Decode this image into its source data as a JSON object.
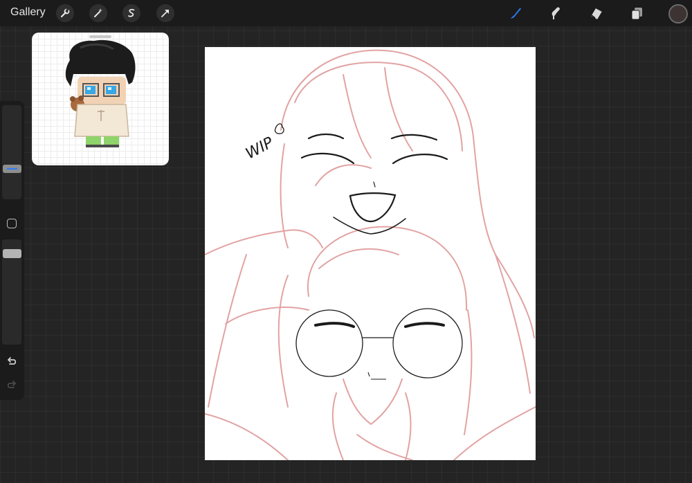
{
  "topbar": {
    "gallery_label": "Gallery",
    "left_tools": [
      "wrench-icon",
      "magic-wand-icon",
      "selection-icon",
      "transform-arrow-icon"
    ],
    "right_tools": [
      "brush-icon",
      "smudge-icon",
      "eraser-icon",
      "layers-icon"
    ],
    "active_tool": "brush-icon",
    "active_color": "#3d3333"
  },
  "colors": {
    "active_tool_accent": "#2f7cf6",
    "sketch_line": "#dc8c8c",
    "ink_line": "#1a1a1a"
  },
  "canvas": {
    "annotation_text": "WIP"
  },
  "sidebar": {
    "size_slider_level": 0.65,
    "opacity_slider_level": 0.9
  }
}
